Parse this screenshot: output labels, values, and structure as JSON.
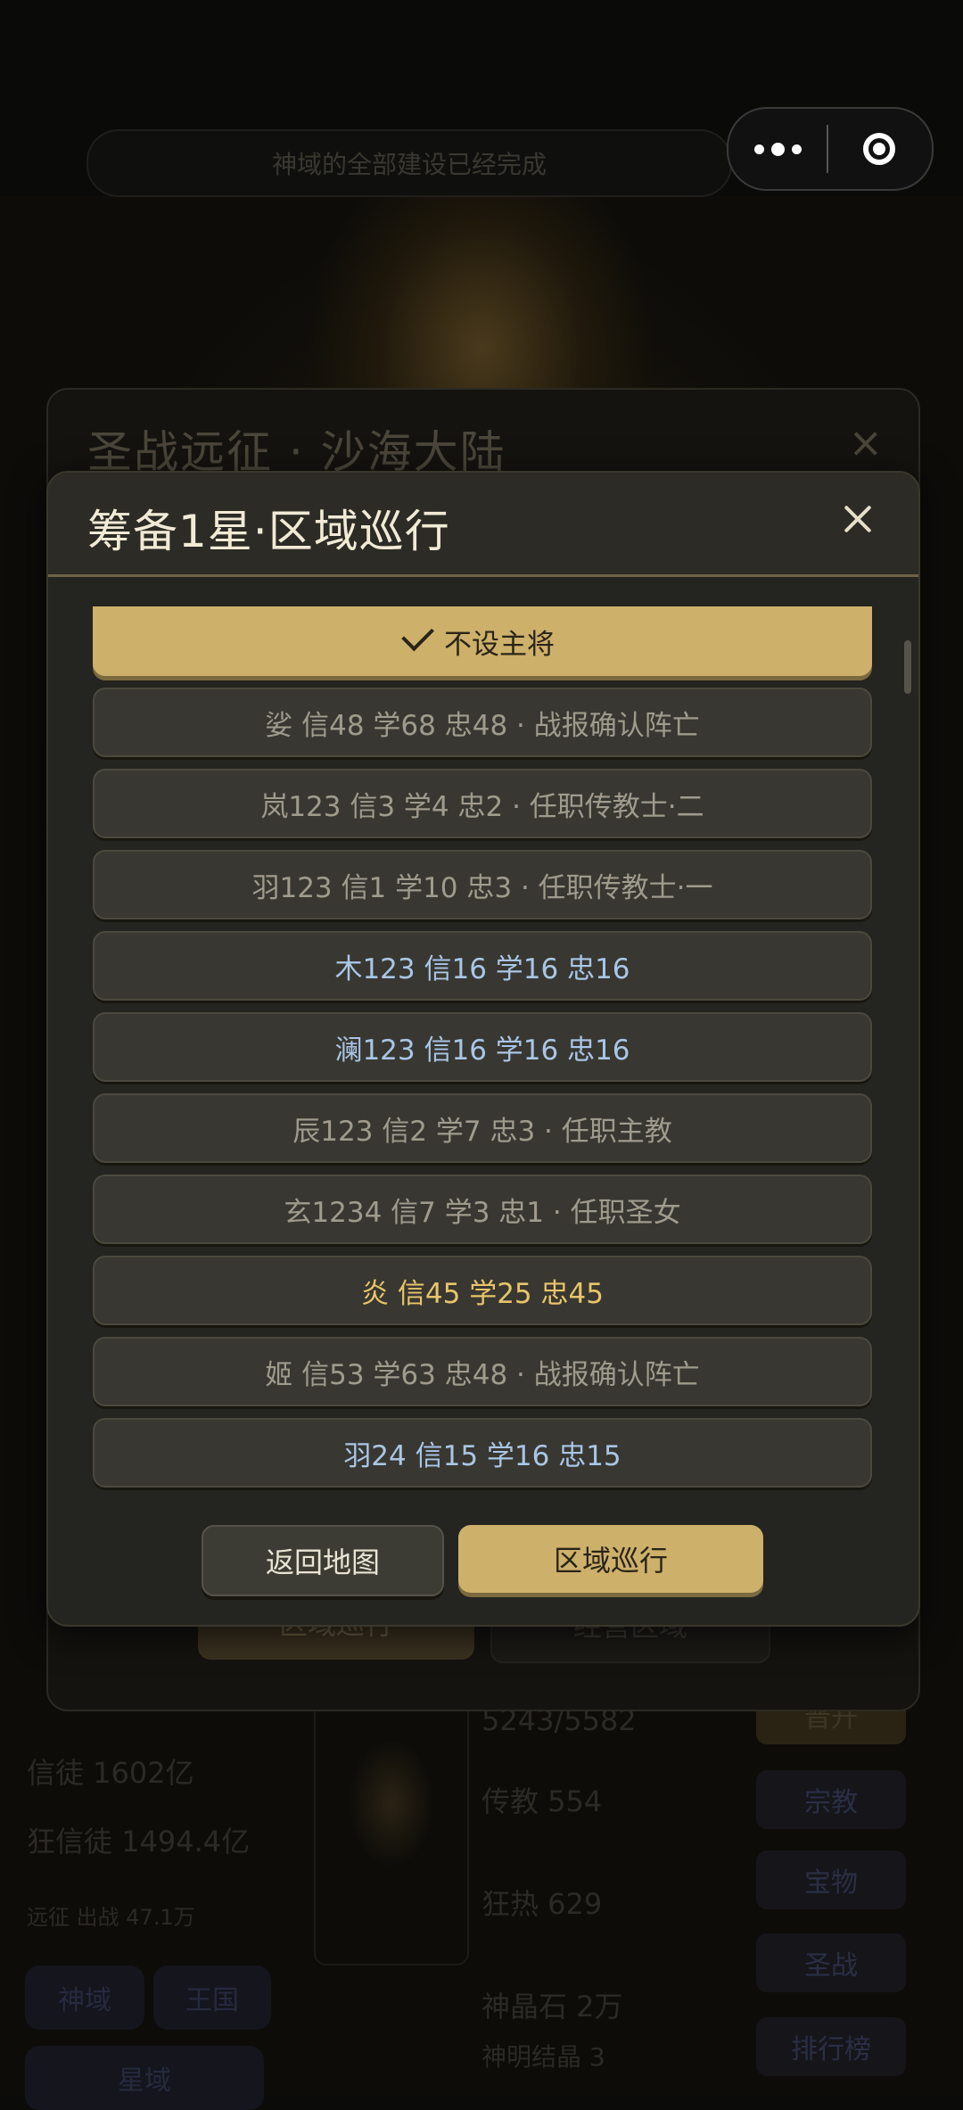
{
  "notice": "神域的全部建设已经完成",
  "capsule": {
    "more_icon": "more-dots-icon",
    "close_icon": "target-close-icon"
  },
  "back_panel": {
    "title": "圣战远征 · 沙海大陆",
    "close": "×",
    "button_patrol": "区域巡行",
    "button_manage": "经营区域"
  },
  "background": {
    "believers": "信徒 1602亿",
    "zealots": "狂信徒 1494.4亿",
    "expedition": "远征 出战 47.1万",
    "progress": "5243/5582",
    "preach": "传教 554",
    "zeal": "狂热 629",
    "crystal": "神晶石 2万",
    "divine_crystal": "神明结晶 3",
    "side_buttons": [
      "晋升",
      "宗教",
      "宝物",
      "圣战",
      "排行榜"
    ],
    "tabs": [
      "神域",
      "王国",
      "星域"
    ]
  },
  "modal": {
    "title": "筹备1星·区域巡行",
    "close_icon": "close-icon",
    "rows": [
      {
        "text": "不设主将",
        "style": "selected"
      },
      {
        "text": "娑  信48 学68 忠48 · 战报确认阵亡",
        "style": "grey"
      },
      {
        "text": "岚123  信3 学4 忠2 · 任职传教士·二",
        "style": "grey"
      },
      {
        "text": "羽123  信1 学10 忠3 · 任职传教士·一",
        "style": "grey"
      },
      {
        "text": "木123  信16 学16 忠16",
        "style": "blue"
      },
      {
        "text": "澜123  信16 学16 忠16",
        "style": "blue"
      },
      {
        "text": "辰123  信2 学7 忠3 · 任职主教",
        "style": "grey"
      },
      {
        "text": "玄1234  信7 学3 忠1 · 任职圣女",
        "style": "grey"
      },
      {
        "text": "炎  信45 学25 忠45",
        "style": "gold"
      },
      {
        "text": "姬  信53 学63 忠48 · 战报确认阵亡",
        "style": "grey"
      },
      {
        "text": "羽24  信15 学16 忠15",
        "style": "blue"
      }
    ],
    "button_return": "返回地图",
    "button_patrol": "区域巡行"
  },
  "colors": {
    "accent_gold": "#cdb06a",
    "text_blue": "#a9c6e6",
    "text_gold": "#e8c56a",
    "text_grey": "#9f9b8d"
  }
}
